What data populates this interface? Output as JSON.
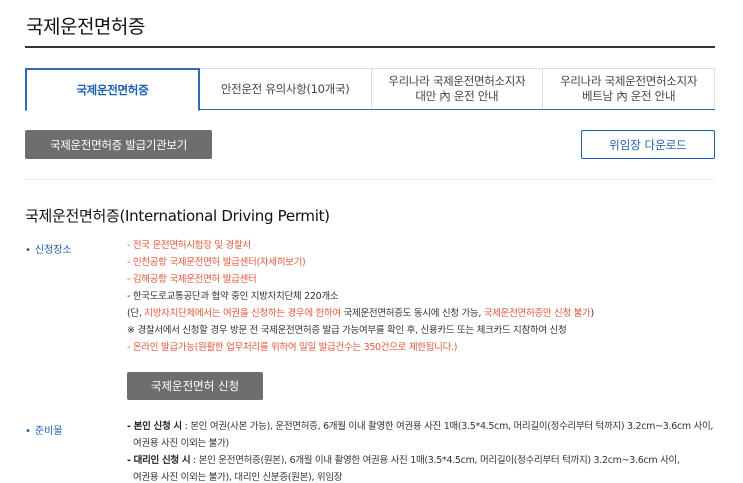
{
  "page": {
    "title": "국제운전면허증"
  },
  "tabs": [
    {
      "line1": "국제운전면허증",
      "line2": ""
    },
    {
      "line1": "안전운전 유의사항(10개국)",
      "line2": ""
    },
    {
      "line1": "우리나라 국제운전면허소지자",
      "line2": "대만 內 운전 안내"
    },
    {
      "line1": "우리나라 국제운전면허소지자",
      "line2": "베트남 內 운전 안내"
    }
  ],
  "buttons": {
    "issuer": "국제운전면허증 발급기관보기",
    "download": "위임장 다운로드",
    "apply": "국제운전면허 신청"
  },
  "section": {
    "title": "국제운전면허증(International Driving Permit)"
  },
  "location": {
    "label": "신청장소",
    "l1": "- 전국 운전면허시험장 및 경찰서",
    "l2": "- 인천공항 국제운전면허 발급센터(자세히보기)",
    "l3": "- 김해공항 국제운전면허 발급센터",
    "l4": "- 한국도로교통공단과 협약 중인 지방자치단체 220개소",
    "l5a": "(단, ",
    "l5b": "지방자치단체에서는 여권을 신청하는 경우에 한하여",
    "l5c": " 국제운전면허증도 동시에 신청 가능, ",
    "l5d": "국제운전면허증만 신청 불가",
    "l5e": ")",
    "l6": "※ 경찰서에서 신청할 경우 방문 전 국제운전면허증 발급 가능여부를 확인 후, 신용카드 또는 체크카드 지참하여 신청",
    "l7": "- 온라인 발급가능(원활한 업무처리를 위하여 일일 발급건수는 350건으로 제한됩니다.)"
  },
  "prep": {
    "label": "준비물",
    "p1a": "- 본인 신청 시",
    "p1b": " : 본인 여권(사본 가능), 운전면허증, 6개월 이내 촬영한 여권용 사진 1매(3.5*4.5cm, 머리길이(정수리부터 턱까지) 3.2cm~3.6cm 사이,",
    "p1c": "여권용 사진 이외는 불가)",
    "p2a": "- 대리인 신청 시",
    "p2b": " : 본인 운전면허증(원본), 6개월 이내 촬영한 여권용 사진 1매(3.5*4.5cm, 머리길이(정수리부터 턱까지) 3.2cm~3.6cm 사이,",
    "p2c": "여권용 사진 이외는 불가), 대리인 신분증(원본), 위임장"
  }
}
